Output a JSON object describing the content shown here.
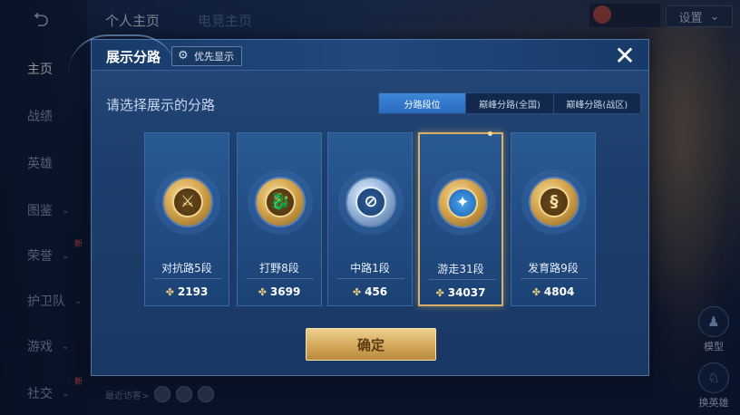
{
  "background": {
    "back_icon": "back-arrow-icon",
    "tabs": [
      "个人主页",
      "电竞主页"
    ],
    "settings_label": "设置",
    "nav_items": [
      {
        "label": "主页",
        "active": true,
        "chevron": false,
        "new": false
      },
      {
        "label": "战绩",
        "active": false,
        "chevron": false,
        "new": false
      },
      {
        "label": "英雄",
        "active": false,
        "chevron": false,
        "new": false
      },
      {
        "label": "图鉴",
        "active": false,
        "chevron": true,
        "new": false
      },
      {
        "label": "荣誉",
        "active": false,
        "chevron": true,
        "new": true
      },
      {
        "label": "护卫队",
        "active": false,
        "chevron": true,
        "new": false
      },
      {
        "label": "游戏",
        "active": false,
        "chevron": true,
        "new": false
      },
      {
        "label": "社交",
        "active": false,
        "chevron": true,
        "new": true
      }
    ],
    "new_badge": "新",
    "recent_visitors_label": "最近访客>",
    "right_actions": [
      {
        "label": "模型",
        "icon": "figure-icon"
      },
      {
        "label": "换英雄",
        "icon": "swap-hero-icon"
      }
    ]
  },
  "modal": {
    "title": "展示分路",
    "priority_button": {
      "icon": "gear-icon",
      "label": "优先显示"
    },
    "close_icon": "close-icon",
    "subtitle": "请选择展示的分路",
    "tabs": [
      {
        "label": "分路段位",
        "active": true
      },
      {
        "label": "巅峰分路(全国)",
        "active": false
      },
      {
        "label": "巅峰分路(战区)",
        "active": false
      }
    ],
    "cards": [
      {
        "label": "对抗路5段",
        "score": "2193",
        "emblem": "clash-lane-emblem",
        "glyph": "⚔",
        "style": "gold",
        "selected": false
      },
      {
        "label": "打野8段",
        "score": "3699",
        "emblem": "jungle-emblem",
        "glyph": "🐉",
        "style": "gold",
        "selected": false
      },
      {
        "label": "中路1段",
        "score": "456",
        "emblem": "mid-lane-emblem",
        "glyph": "⊘",
        "style": "blue",
        "selected": false
      },
      {
        "label": "游走31段",
        "score": "34037",
        "emblem": "roam-emblem",
        "glyph": "✦",
        "style": "cyan",
        "selected": true
      },
      {
        "label": "发育路9段",
        "score": "4804",
        "emblem": "farm-lane-emblem",
        "glyph": "§",
        "style": "gold",
        "selected": false
      }
    ],
    "score_icon": "wheat-icon",
    "confirm_label": "确定"
  },
  "colors": {
    "accent_gold": "#d9b064",
    "active_tab_blue": "#3d87d9",
    "modal_bg": "#1d3e6c"
  }
}
